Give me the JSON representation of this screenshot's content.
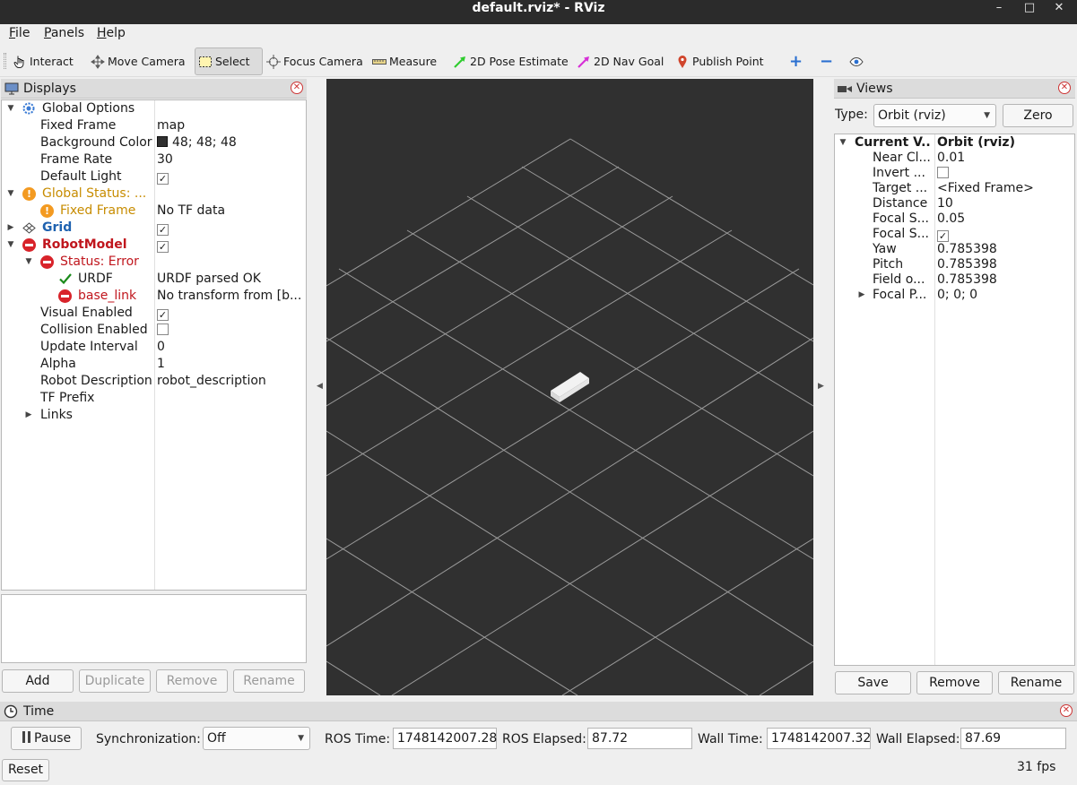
{
  "window": {
    "title": "default.rviz* - RViz",
    "minimize": "–",
    "maximize": "□",
    "close": "✕"
  },
  "menu": [
    {
      "key": "F",
      "rest": "ile"
    },
    {
      "key": "P",
      "rest": "anels"
    },
    {
      "key": "H",
      "rest": "elp"
    }
  ],
  "toolbar": {
    "interact": "Interact",
    "move_camera": "Move Camera",
    "select": "Select",
    "focus_camera": "Focus Camera",
    "measure": "Measure",
    "pose_estimate": "2D Pose Estimate",
    "nav_goal": "2D Nav Goal",
    "publish_point": "Publish Point",
    "add_tool": "+",
    "remove_tool": "−"
  },
  "displays": {
    "title": "Displays",
    "rows": {
      "global_options": "Global Options",
      "fixed_frame": {
        "label": "Fixed Frame",
        "value": "map"
      },
      "background_color": {
        "label": "Background Color",
        "value": "48; 48; 48",
        "swatch": "#303030"
      },
      "frame_rate": {
        "label": "Frame Rate",
        "value": "30"
      },
      "default_light": {
        "label": "Default Light",
        "checked": "✓"
      },
      "global_status": "Global Status: ...",
      "status_fixed_frame": {
        "label": "Fixed Frame",
        "value": "No TF data"
      },
      "grid": {
        "label": "Grid",
        "checked": "✓"
      },
      "robot_model": {
        "label": "RobotModel",
        "checked": "✓"
      },
      "status_error": "Status: Error",
      "urdf": {
        "label": "URDF",
        "value": "URDF parsed OK"
      },
      "base_link": {
        "label": "base_link",
        "value": "No transform from [b..."
      },
      "visual_enabled": {
        "label": "Visual Enabled",
        "checked": "✓"
      },
      "collision_enabled": {
        "label": "Collision Enabled",
        "checked": ""
      },
      "update_interval": {
        "label": "Update Interval",
        "value": "0"
      },
      "alpha": {
        "label": "Alpha",
        "value": "1"
      },
      "robot_description": {
        "label": "Robot Description",
        "value": "robot_description"
      },
      "tf_prefix": {
        "label": "TF Prefix",
        "value": ""
      },
      "links": {
        "label": "Links"
      }
    },
    "buttons": {
      "add": "Add",
      "duplicate": "Duplicate",
      "remove": "Remove",
      "rename": "Rename"
    }
  },
  "views": {
    "title": "Views",
    "type_label": "Type:",
    "type_value": "Orbit (rviz)",
    "zero": "Zero",
    "rows": {
      "current_view": {
        "label": "Current V...",
        "value": "Orbit (rviz)"
      },
      "near_clip": {
        "label": "Near Cl...",
        "value": "0.01"
      },
      "invert": {
        "label": "Invert ...",
        "checked": ""
      },
      "target": {
        "label": "Target ...",
        "value": "<Fixed Frame>"
      },
      "distance": {
        "label": "Distance",
        "value": "10"
      },
      "focal_shape_size": {
        "label": "Focal S...",
        "value": "0.05"
      },
      "focal_shape_fixed": {
        "label": "Focal S...",
        "checked": "✓"
      },
      "yaw": {
        "label": "Yaw",
        "value": "0.785398"
      },
      "pitch": {
        "label": "Pitch",
        "value": "0.785398"
      },
      "field_of_view": {
        "label": "Field o...",
        "value": "0.785398"
      },
      "focal_point": {
        "label": "Focal P...",
        "value": "0; 0; 0"
      }
    },
    "buttons": {
      "save": "Save",
      "remove": "Remove",
      "rename": "Rename"
    }
  },
  "time": {
    "title": "Time",
    "pause": "Pause",
    "sync_label": "Synchronization:",
    "sync_value": "Off",
    "ros_time_label": "ROS Time:",
    "ros_time": "1748142007.28",
    "ros_elapsed_label": "ROS Elapsed:",
    "ros_elapsed": "87.72",
    "wall_time_label": "Wall Time:",
    "wall_time": "1748142007.32",
    "wall_elapsed_label": "Wall Elapsed:",
    "wall_elapsed": "87.69",
    "reset": "Reset",
    "fps": "31 fps"
  },
  "colors": {
    "render_bg": "#303030",
    "grid_line": "#a0a0a0",
    "error": "#d8232a",
    "warning": "#f39a21",
    "ok": "#1a8a1a"
  }
}
